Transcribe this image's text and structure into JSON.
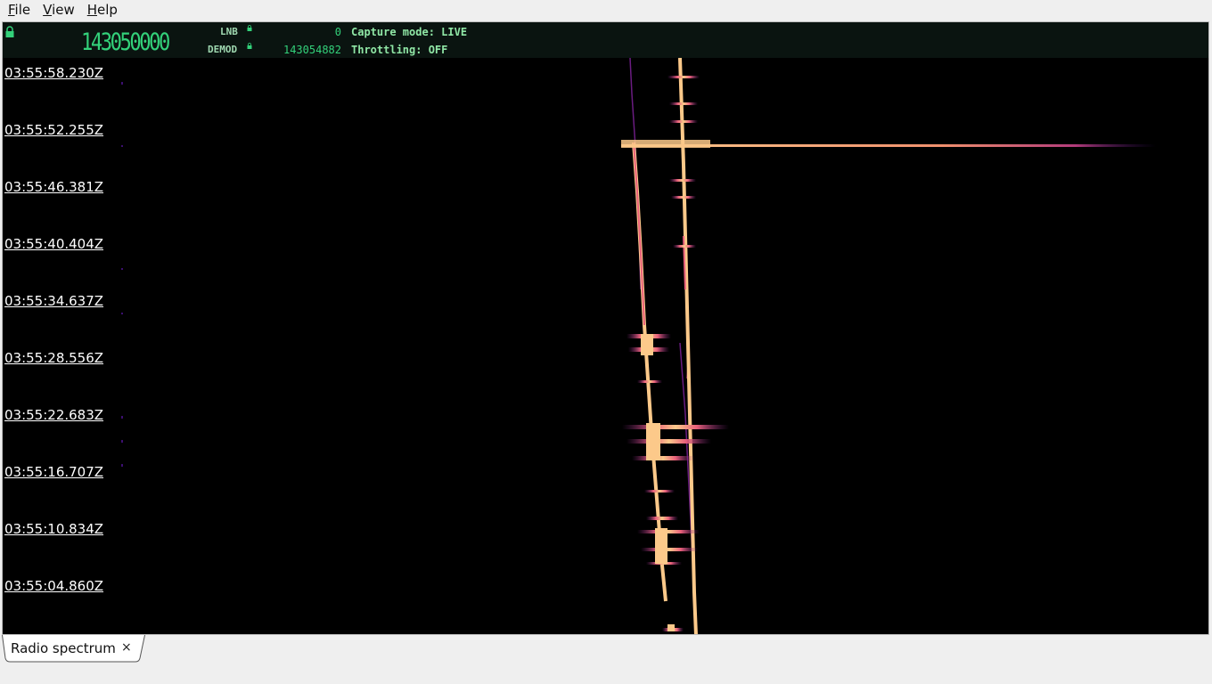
{
  "menu": {
    "file": {
      "mnemonic": "F",
      "rest": "ile"
    },
    "view": {
      "mnemonic": "V",
      "rest": "iew"
    },
    "help": {
      "mnemonic": "H",
      "rest": "elp"
    }
  },
  "header": {
    "main_frequency": "143050000",
    "lnb_label": "LNB",
    "lnb_value": "0",
    "demod_label": "DEMOD",
    "demod_value": "143054882",
    "capture_mode": "Capture mode: LIVE",
    "throttling": "Throttling: OFF",
    "accent_color": "#33d17a"
  },
  "waterfall": {
    "timestamps": [
      "03:55:58.230Z",
      "03:55:52.255Z",
      "03:55:46.381Z",
      "03:55:40.404Z",
      "03:55:34.637Z",
      "03:55:28.556Z",
      "03:55:22.683Z",
      "03:55:16.707Z",
      "03:55:10.834Z",
      "03:55:04.860Z"
    ],
    "colormap": "magma"
  },
  "tabs": [
    {
      "label": "Radio spectrum",
      "close": "×"
    }
  ]
}
